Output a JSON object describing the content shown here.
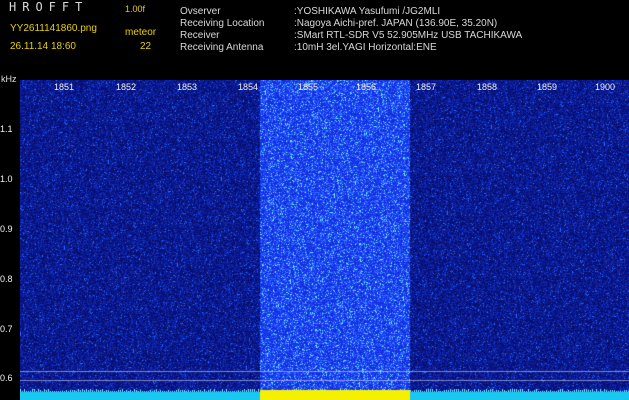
{
  "header": {
    "brand": "HROFFT",
    "version": "1.00f",
    "filename": "YY2611141860.png",
    "datetime": "26.11.14 18:60",
    "meteor_label": "meteor",
    "meteor_count": "22"
  },
  "info": [
    {
      "key": "Ovserver",
      "value": ":YOSHIKAWA Yasufumi /JG2MLI"
    },
    {
      "key": "Receiving Location",
      "value": ":Nagoya Aichi-pref. JAPAN (136.90E, 35.20N)"
    },
    {
      "key": "Receiver",
      "value": ":SMart RTL-SDR V5 52.905MHz USB TACHIKAWA"
    },
    {
      "key": "Receiving Antenna",
      "value": ":10mH 3el.YAGI Horizontal:ENE"
    }
  ],
  "axis": {
    "unit": "kHz",
    "time_ticks": [
      "1851",
      "1852",
      "1853",
      "1854",
      "1855",
      "1856",
      "1857",
      "1858",
      "1859",
      "1900"
    ],
    "freq_ticks": [
      "1.1",
      "1.0",
      "0.9",
      "0.8",
      "0.7",
      "0.6"
    ]
  },
  "colors": {
    "background": "#000000",
    "noise_low": "#0c1a8c",
    "noise_high": "#1e3cff",
    "burst": "#2a50ff",
    "burst_hot": "#7cf0ff",
    "baseline": "#18c8f0",
    "burst_baseline": "#f5f000",
    "header_yellow": "#e7d100"
  }
}
